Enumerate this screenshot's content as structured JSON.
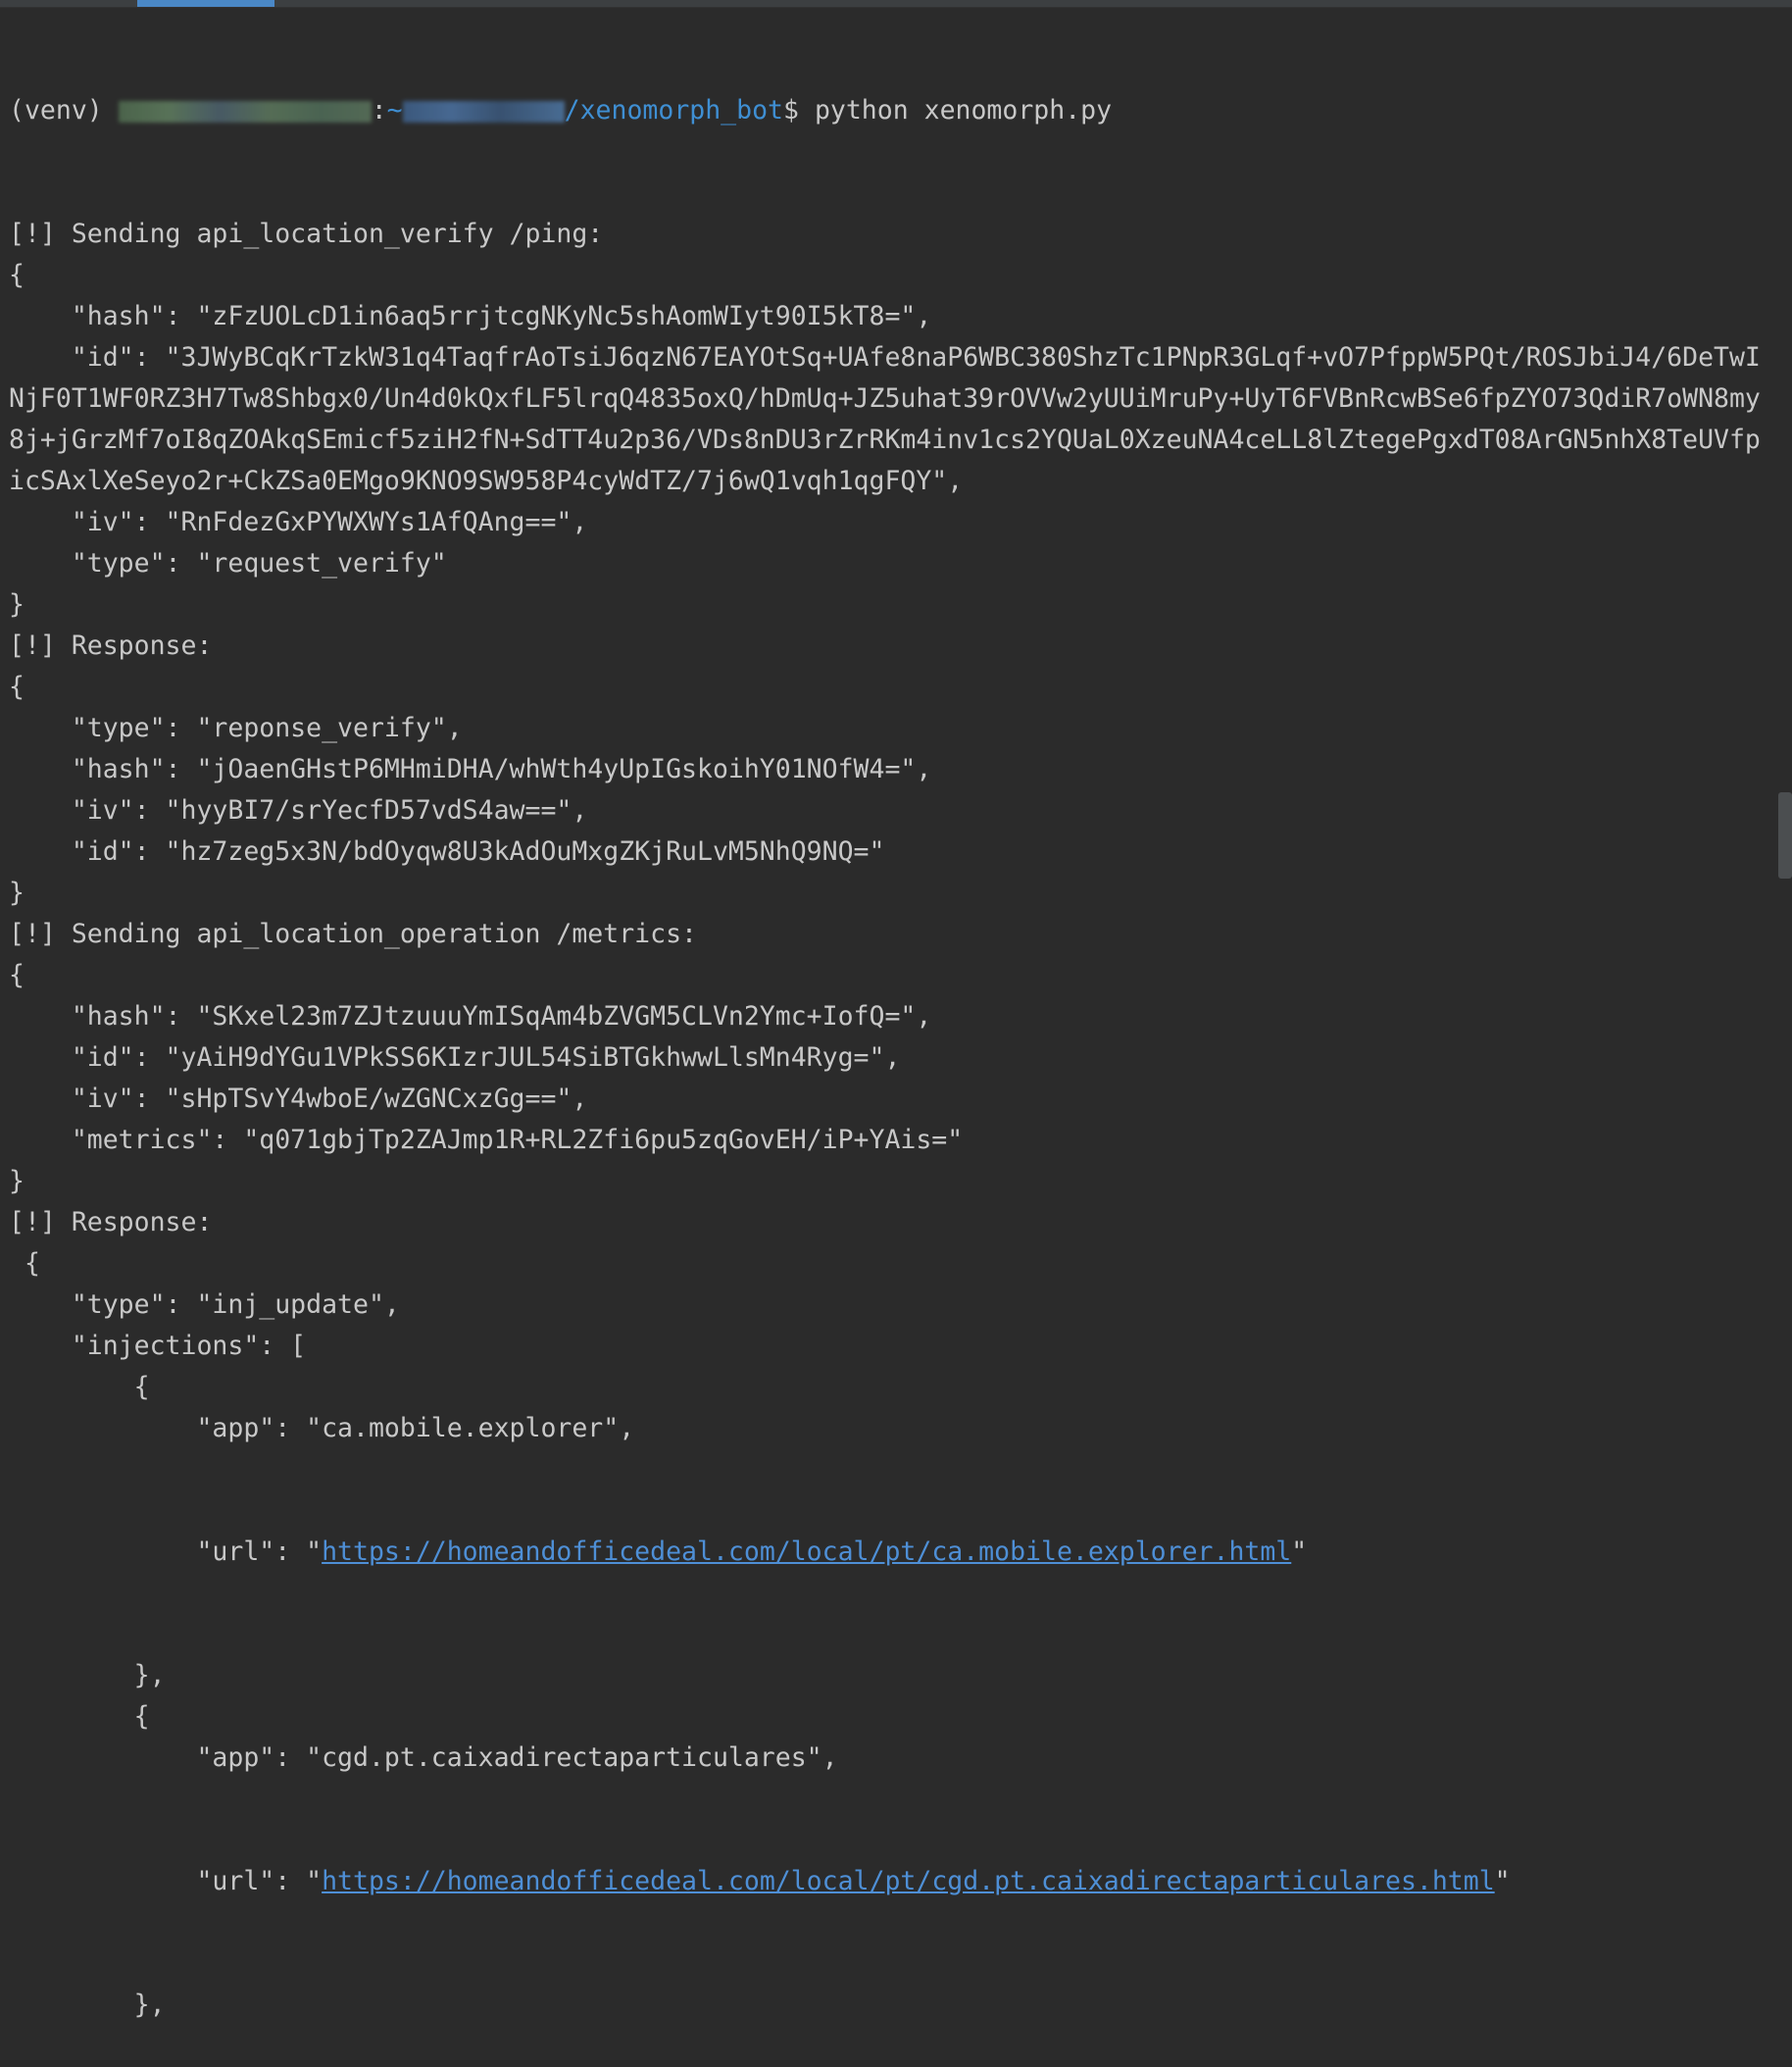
{
  "terminal": {
    "prompt": {
      "venv": "(venv)",
      "colon": ":",
      "tilde": "~",
      "path_tail": "/xenomorph_bot",
      "dollar": "$",
      "command": " python xenomorph.py"
    },
    "lines": [
      "[!] Sending api_location_verify /ping:",
      "{",
      "    \"hash\": \"zFzUOLcD1in6aq5rrjtcgNKyNc5shAomWIyt90I5kT8=\",",
      "    \"id\": \"3JWyBCqKrTzkW31q4TaqfrAoTsiJ6qzN67EAYOtSq+UAfe8naP6WBC380ShzTc1PNpR3GLqf+vO7PfppW5PQt/ROSJbiJ4/6DeTwI",
      "NjF0T1WF0RZ3H7Tw8Shbgx0/Un4d0kQxfLF5lrqQ4835oxQ/hDmUq+JZ5uhat39rOVVw2yUUiMruPy+UyT6FVBnRcwBSe6fpZYO73QdiR7oWN8my",
      "8j+jGrzMf7oI8qZOAkqSEmicf5ziH2fN+SdTT4u2p36/VDs8nDU3rZrRKm4inv1cs2YQUaL0XzeuNA4ceLL8lZtegePgxdT08ArGN5nhX8TeUVfp",
      "icSAxlXeSeyo2r+CkZSa0EMgo9KNO9SW958P4cyWdTZ/7j6wQ1vqh1qgFQY\",",
      "    \"iv\": \"RnFdezGxPYWXWYs1AfQAng==\",",
      "    \"type\": \"request_verify\"",
      "}",
      "[!] Response:",
      "{",
      "    \"type\": \"reponse_verify\",",
      "    \"hash\": \"jOaenGHstP6MHmiDHA/whWth4yUpIGskoihY01NOfW4=\",",
      "    \"iv\": \"hyyBI7/srYecfD57vdS4aw==\",",
      "    \"id\": \"hz7zeg5x3N/bdOyqw8U3kAdOuMxgZKjRuLvM5NhQ9NQ=\"",
      "}",
      "[!] Sending api_location_operation /metrics:",
      "{",
      "    \"hash\": \"SKxel23m7ZJtzuuuYmISqAm4bZVGM5CLVn2Ymc+IofQ=\",",
      "    \"id\": \"yAiH9dYGu1VPkSS6KIzrJUL54SiBTGkhwwLlsMn4Ryg=\",",
      "    \"iv\": \"sHpTSvY4wboE/wZGNCxzGg==\",",
      "    \"metrics\": \"q071gbjTp2ZAJmp1R+RL2Zfi6pu5zqGovEH/iP+YAis=\"",
      "}",
      "[!] Response:",
      " {",
      "    \"type\": \"inj_update\",",
      "    \"injections\": [",
      "        {",
      "            \"app\": \"ca.mobile.explorer\","
    ],
    "url_line_1": {
      "prefix": "            \"url\": \"",
      "link": "https://homeandofficedeal.com/local/pt/ca.mobile.explorer.html",
      "suffix": "\""
    },
    "lines_2": [
      "        },",
      "        {",
      "            \"app\": \"cgd.pt.caixadirectaparticulares\","
    ],
    "url_line_2": {
      "prefix": "            \"url\": \"",
      "link": "https://homeandofficedeal.com/local/pt/cgd.pt.caixadirectaparticulares.html",
      "suffix": "\""
    },
    "lines_3": [
      "        },"
    ]
  },
  "colors": {
    "background": "#2b2b2b",
    "text": "#c8c8c8",
    "prompt_blue": "#3f8fd3",
    "link": "#4e8fd6"
  }
}
